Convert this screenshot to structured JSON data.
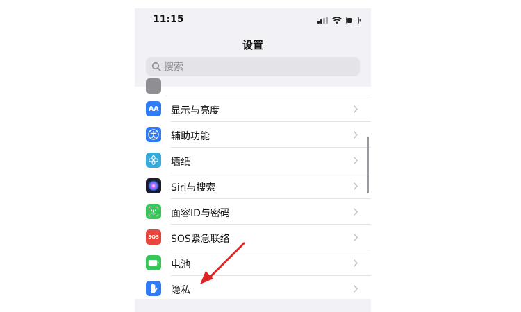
{
  "status_bar": {
    "time": "11:15"
  },
  "nav": {
    "title": "设置"
  },
  "search": {
    "placeholder": "搜索"
  },
  "settings_items": [
    {
      "label": "显示与亮度",
      "icon": "display-brightness-icon",
      "color": "#2f7cf6"
    },
    {
      "label": "辅助功能",
      "icon": "accessibility-icon",
      "color": "#2f7cf6"
    },
    {
      "label": "墙纸",
      "icon": "wallpaper-icon",
      "color": "#35aadc"
    },
    {
      "label": "Siri与搜索",
      "icon": "siri-icon",
      "color": "#1b1b2f"
    },
    {
      "label": "面容ID与密码",
      "icon": "face-id-icon",
      "color": "#36c759"
    },
    {
      "label": "SOS紧急联络",
      "icon": "sos-icon",
      "color": "#e8453c"
    },
    {
      "label": "电池",
      "icon": "battery-settings-icon",
      "color": "#36c759"
    },
    {
      "label": "隐私",
      "icon": "privacy-hand-icon",
      "color": "#2f7cf6"
    }
  ],
  "sos_icon_text": "SOS",
  "display_icon_text": "AA",
  "colors": {
    "annotation_arrow": "#e02424",
    "background": "#f2f2f6",
    "separator": "#e3e3e6"
  }
}
